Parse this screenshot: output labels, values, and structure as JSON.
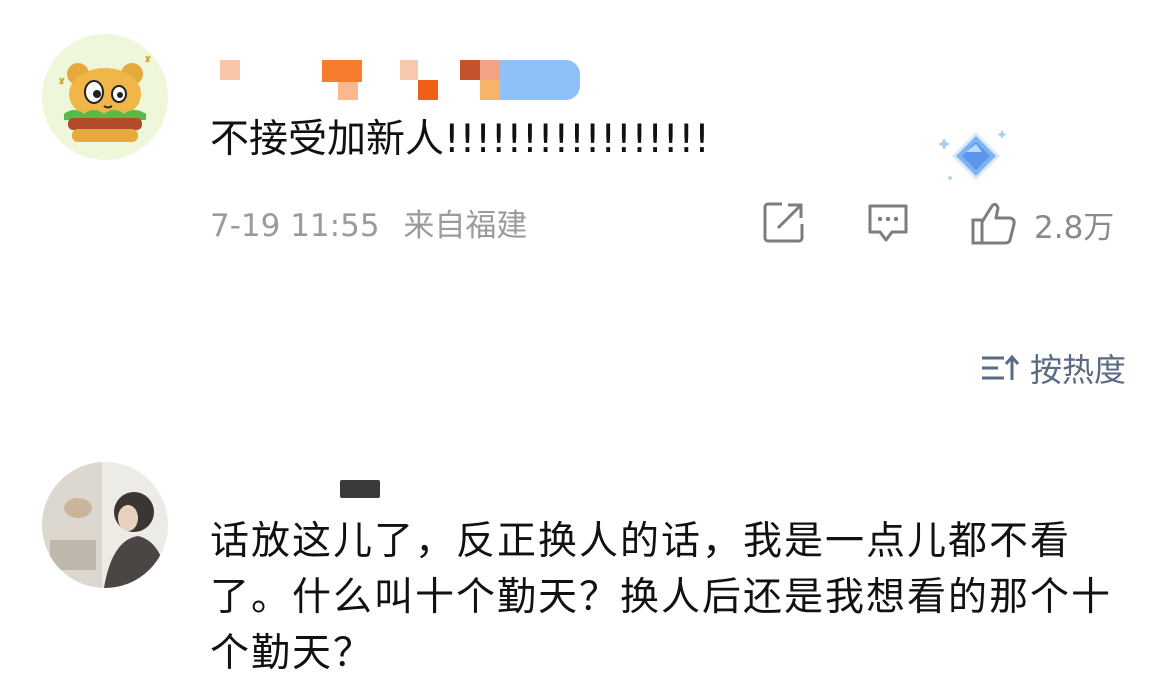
{
  "comments": [
    {
      "text": "不接受加新人!!!!!!!!!!!!!!!!!",
      "date": "7-19 11:55",
      "location": "来自福建",
      "likes": "2.8万",
      "icons": [
        "edit-share-icon",
        "comment-icon",
        "thumbs-up-icon"
      ]
    },
    {
      "text": "话放这儿了，反正换人的话，我是一点儿都不看了。什么叫十个勤天？换人后还是我想看的那个十个勤天？"
    }
  ],
  "sort": {
    "label": "按热度",
    "icon": "sort-icon"
  },
  "colors": {
    "meta_text": "#9b9b9b",
    "sort_text": "#5b6b84",
    "body_text": "#111111"
  }
}
